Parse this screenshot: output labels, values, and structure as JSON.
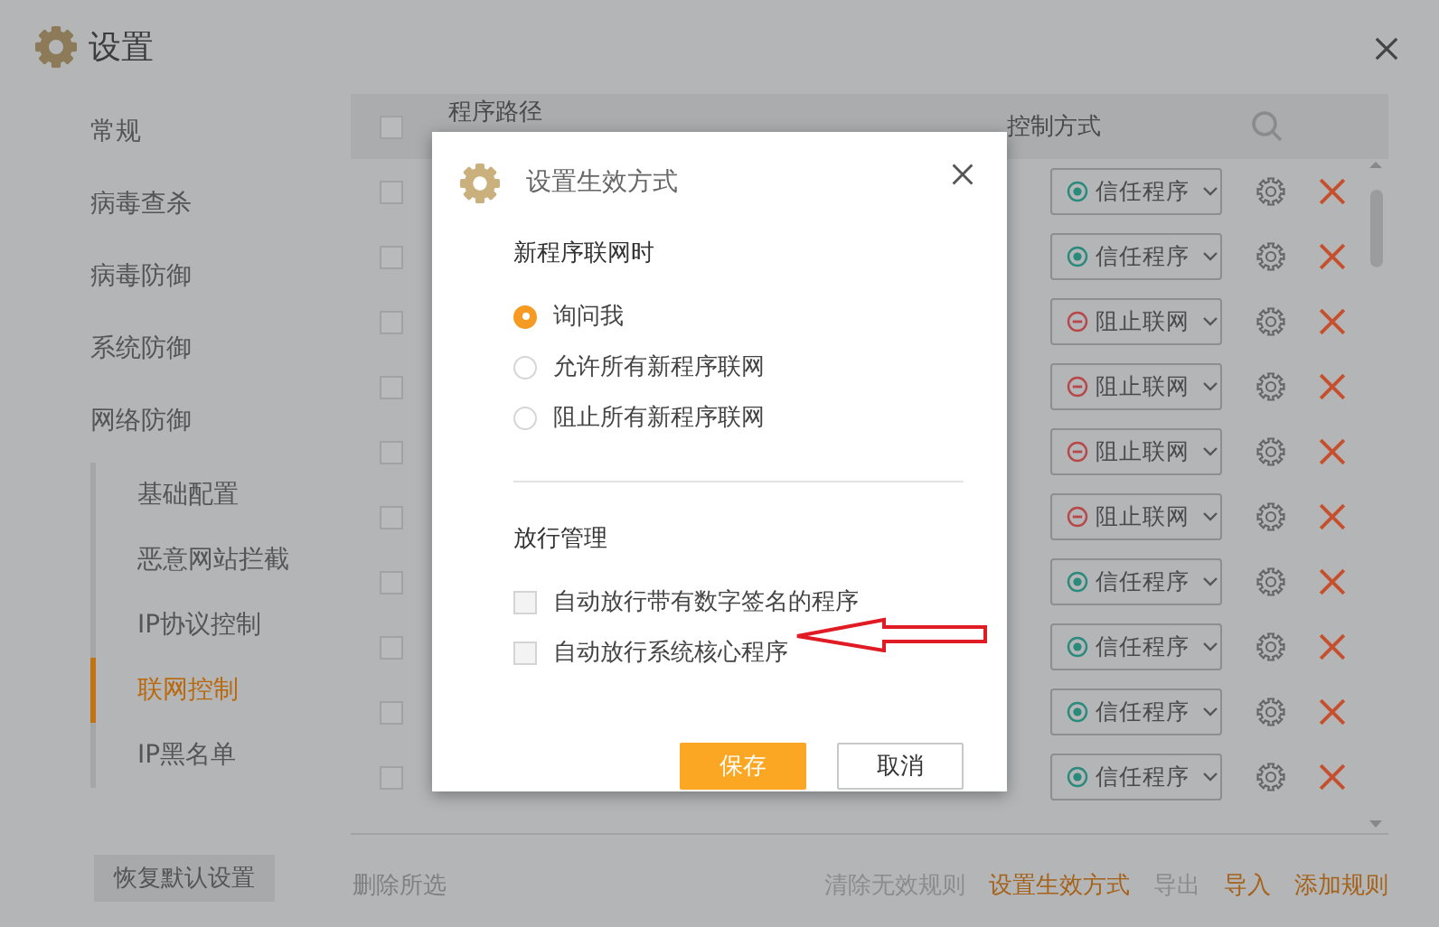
{
  "window": {
    "title": "设置"
  },
  "sidebar": {
    "items": [
      {
        "label": "常规",
        "selected": false
      },
      {
        "label": "病毒查杀",
        "selected": false
      },
      {
        "label": "病毒防御",
        "selected": false
      },
      {
        "label": "系统防御",
        "selected": false
      },
      {
        "label": "网络防御",
        "selected": false,
        "children": [
          {
            "label": "基础配置",
            "selected": false
          },
          {
            "label": "恶意网站拦截",
            "selected": false
          },
          {
            "label": "IP协议控制",
            "selected": false
          },
          {
            "label": "联网控制",
            "selected": true
          },
          {
            "label": "IP黑名单",
            "selected": false
          }
        ]
      }
    ]
  },
  "table": {
    "header_checked": false,
    "columns": [
      "程序路径",
      "控制方式"
    ],
    "rows": [
      {
        "checked": false,
        "kind": "trust",
        "mode": "信任程序"
      },
      {
        "checked": false,
        "kind": "trust",
        "mode": "信任程序"
      },
      {
        "checked": false,
        "kind": "block",
        "mode": "阻止联网"
      },
      {
        "checked": false,
        "kind": "block",
        "mode": "阻止联网"
      },
      {
        "checked": false,
        "kind": "block",
        "mode": "阻止联网"
      },
      {
        "checked": false,
        "kind": "block",
        "mode": "阻止联网"
      },
      {
        "checked": false,
        "kind": "trust",
        "mode": "信任程序"
      },
      {
        "checked": false,
        "kind": "trust",
        "mode": "信任程序"
      },
      {
        "checked": false,
        "kind": "trust",
        "mode": "信任程序"
      },
      {
        "checked": false,
        "kind": "trust",
        "mode": "信任程序"
      }
    ]
  },
  "footer": {
    "reset_button": "恢复默认设置",
    "delete_selected": "删除所选",
    "actions": [
      {
        "label": "清除无效规则",
        "kind": "plain"
      },
      {
        "label": "设置生效方式",
        "kind": "accent"
      },
      {
        "label": "导出",
        "kind": "plain"
      },
      {
        "label": "导入",
        "kind": "accent"
      },
      {
        "label": "添加规则",
        "kind": "accent"
      }
    ]
  },
  "dialog": {
    "title": "设置生效方式",
    "network_section": {
      "heading": "新程序联网时",
      "options": [
        {
          "label": "询问我",
          "selected": true
        },
        {
          "label": "允许所有新程序联网",
          "selected": false
        },
        {
          "label": "阻止所有新程序联网",
          "selected": false
        }
      ]
    },
    "allow_section": {
      "heading": "放行管理",
      "options": [
        {
          "label": "自动放行带有数字签名的程序",
          "checked": false
        },
        {
          "label": "自动放行系统核心程序",
          "checked": false
        }
      ]
    },
    "buttons": [
      {
        "label": "保存",
        "kind": "primary"
      },
      {
        "label": "取消",
        "kind": "secondary"
      }
    ]
  }
}
